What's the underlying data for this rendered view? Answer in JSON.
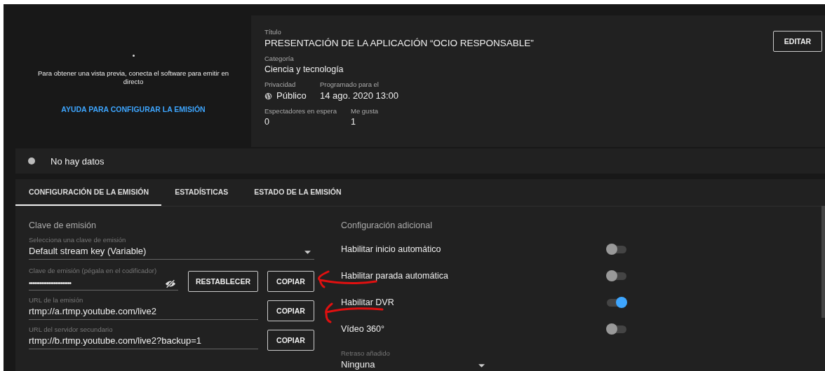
{
  "preview": {
    "message": "Para obtener una vista previa, conecta el software para emitir en directo",
    "help_link": "AYUDA PARA CONFIGURAR LA EMISIÓN"
  },
  "details": {
    "title_label": "Título",
    "title": "PRESENTACIÓN DE LA APLICACIÓN “OCIO RESPONSABLE”",
    "category_label": "Categoría",
    "category": "Ciencia y tecnología",
    "privacy_label": "Privacidad",
    "privacy": "Público",
    "scheduled_label": "Programado para el",
    "scheduled": "14 ago. 2020 13:00",
    "waiting_label": "Espectadores en espera",
    "waiting": "0",
    "likes_label": "Me gusta",
    "likes": "1",
    "edit_button": "EDITAR"
  },
  "status": {
    "text": "No hay datos"
  },
  "tabs": [
    {
      "label": "CONFIGURACIÓN DE LA EMISIÓN",
      "selected": true
    },
    {
      "label": "ESTADÍSTICAS",
      "selected": false
    },
    {
      "label": "ESTADO DE LA EMISIÓN",
      "selected": false
    }
  ],
  "stream_key": {
    "heading": "Clave de emisión",
    "select_label": "Selecciona una clave de emisión",
    "select_value": "Default stream key (Variable)",
    "key_label": "Clave de emisión (pégala en el codificador)",
    "key_value": "••••••••••••••••••••••••",
    "reset_button": "RESTABLECER",
    "copy_button": "COPIAR",
    "url_label": "URL de la emisión",
    "url": "rtmp://a.rtmp.youtube.com/live2",
    "url_copy": "COPIAR",
    "backup_label": "URL del servidor secundario",
    "backup_url": "rtmp://b.rtmp.youtube.com/live2?backup=1",
    "backup_copy": "COPIAR"
  },
  "additional": {
    "heading": "Configuración adicional",
    "toggles": [
      {
        "label": "Habilitar inicio automático",
        "on": false
      },
      {
        "label": "Habilitar parada automática",
        "on": false
      },
      {
        "label": "Habilitar DVR",
        "on": true
      },
      {
        "label": "Vídeo 360°",
        "on": false
      }
    ],
    "delay_label": "Retraso añadido",
    "delay_value": "Ninguna"
  }
}
